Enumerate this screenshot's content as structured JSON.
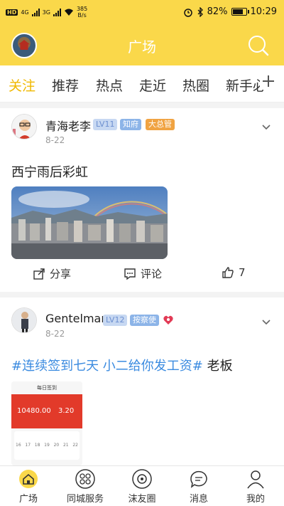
{
  "status_bar": {
    "net_left": "HD",
    "sig1": "4G",
    "sig2": "3G",
    "speed_value": "385",
    "speed_unit": "B/s",
    "battery": "82%",
    "battery_level": 0.82,
    "time": "10:29"
  },
  "header": {
    "title": "广场",
    "search_icon": "search-icon",
    "avatar_icon": "avatar"
  },
  "tabs": [
    {
      "label": "关注",
      "active": true
    },
    {
      "label": "推荐",
      "active": false
    },
    {
      "label": "热点",
      "active": false
    },
    {
      "label": "走近",
      "active": false
    },
    {
      "label": "热圈",
      "active": false
    },
    {
      "label": "新手必",
      "active": false
    }
  ],
  "posts": [
    {
      "author": "青海老李",
      "level": "LV11",
      "role": "知府",
      "role2": "大总管",
      "date": "8-22",
      "text": "西宁雨后彩虹",
      "share_label": "分享",
      "comment_label": "评论",
      "like_count": "7"
    },
    {
      "author": "Gentelman",
      "level": "LV12",
      "role": "按察使",
      "date": "8-22",
      "text_tag": "#连续签到七天 小二给你发工资#",
      "text_rest": " 老板",
      "screenshot": {
        "header": "每日签到",
        "amount1": "10480.00",
        "amount2": "3.20",
        "days": [
          "16",
          "17",
          "18",
          "19",
          "20",
          "21",
          "22"
        ]
      }
    }
  ],
  "bottom_nav": [
    {
      "label": "广场",
      "icon": "home-icon",
      "active": true
    },
    {
      "label": "同城服务",
      "icon": "grid-icon",
      "active": false
    },
    {
      "label": "沫友圈",
      "icon": "circle-icon",
      "active": false
    },
    {
      "label": "消息",
      "icon": "message-icon",
      "active": false
    },
    {
      "label": "我的",
      "icon": "profile-icon",
      "active": false
    }
  ],
  "colors": {
    "accent": "#fad84a",
    "tab_active": "#f0b800",
    "tag_blue": "#3b8be0"
  }
}
